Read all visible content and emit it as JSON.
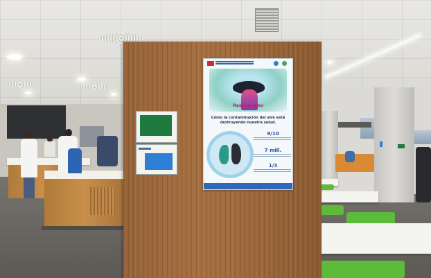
{
  "scene": {
    "description_free": true,
    "colors": {
      "wood_panel": "#a56f41",
      "poster_accent": "#c2186b",
      "poster_blue": "#1d4fa0",
      "chairs": "#5dbb3a"
    }
  },
  "poster": {
    "title": "Respira sano",
    "subtitle": "Cómo la contaminación del aire está destruyendo nuestra salud.",
    "stats": [
      {
        "value": "9/10"
      },
      {
        "value": "7 mill."
      },
      {
        "value": "1/3"
      }
    ]
  },
  "icons": {
    "poster_logo": "madrid-logo",
    "poster_badges": "badge-icons"
  }
}
